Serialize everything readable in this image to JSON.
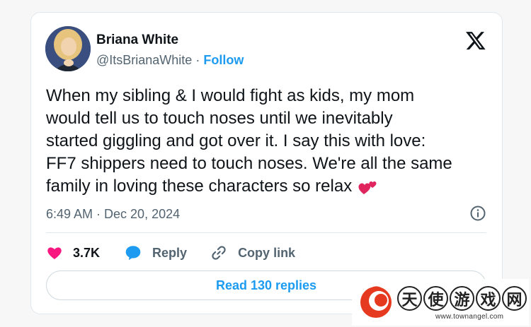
{
  "user": {
    "display_name": "Briana White",
    "handle": "@ItsBrianaWhite",
    "separator": " · ",
    "follow_label": "Follow"
  },
  "tweet": {
    "lines": [
      "When my sibling & I would fight as kids, my mom",
      "would tell us to touch noses until we inevitably",
      "started giggling and got over it. I say this with love:",
      "FF7 shippers need to touch noses. We're all the same",
      "family in loving these characters so relax"
    ],
    "emoji": "two-hearts-emoji",
    "timestamp": "6:49 AM · Dec 20, 2024"
  },
  "actions": {
    "like_count": "3.7K",
    "reply_label": "Reply",
    "copy_link_label": "Copy link",
    "read_replies_label": "Read 130 replies"
  },
  "icons": {
    "brand": "x-logo-icon",
    "info": "info-icon",
    "like": "heart-icon",
    "reply": "speech-bubble-icon",
    "copy": "link-icon"
  },
  "colors": {
    "accent": "#1d9bf0",
    "like": "#f91880",
    "text": "#0f1419",
    "muted": "#536471"
  },
  "watermark": {
    "chars": [
      "天",
      "使",
      "游",
      "戏",
      "网"
    ],
    "url": "www.townangel.com"
  }
}
